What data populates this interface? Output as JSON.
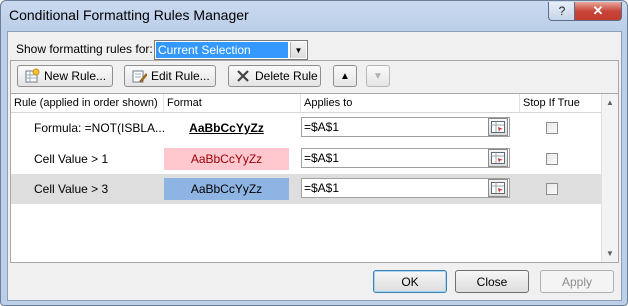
{
  "window": {
    "title": "Conditional Formatting Rules Manager",
    "help_glyph": "?",
    "close_glyph": "✕"
  },
  "show_rules": {
    "label": "Show formatting rules for:",
    "selected": "Current Selection"
  },
  "toolbar": {
    "new_rule": "New Rule...",
    "edit_rule": "Edit Rule...",
    "delete_rule": "Delete Rule",
    "move_up_glyph": "▲",
    "move_down_glyph": "▼"
  },
  "columns": {
    "rule": "Rule (applied in order shown)",
    "format": "Format",
    "applies_to": "Applies to",
    "stop_if_true": "Stop If True"
  },
  "rules": [
    {
      "rule": "Formula: =NOT(ISBLA...",
      "preview": "AaBbCcYyZz",
      "preview_style": "bold-underline",
      "preview_bg": "#ffffff",
      "preview_color": "#000000",
      "applies_to": "=$A$1",
      "stop_if_true": false
    },
    {
      "rule": "Cell Value > 1",
      "preview": "AaBbCcYyZz",
      "preview_style": "normal",
      "preview_bg": "#ffc7ce",
      "preview_color": "#9c0006",
      "applies_to": "=$A$1",
      "stop_if_true": false
    },
    {
      "rule": "Cell Value > 3",
      "preview": "AaBbCcYyZz",
      "preview_style": "normal",
      "preview_bg": "#8db4e2",
      "preview_color": "#000000",
      "applies_to": "=$A$1",
      "stop_if_true": false
    }
  ],
  "footer": {
    "ok": "OK",
    "close": "Close",
    "apply": "Apply"
  },
  "colors": {
    "selection_blue": "#3399ff",
    "selected_row": "#dedede"
  }
}
